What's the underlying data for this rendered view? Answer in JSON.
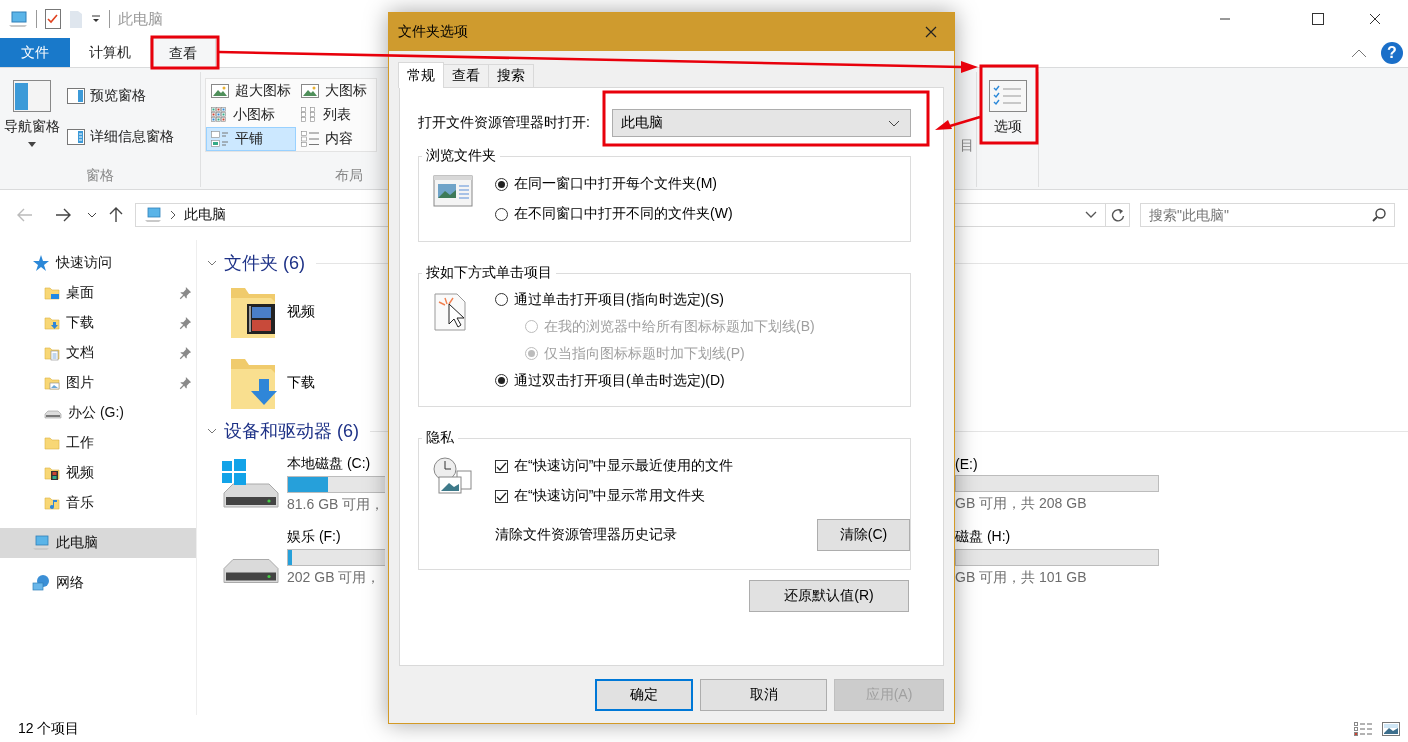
{
  "window": {
    "title": "此电脑"
  },
  "ribbon_tabs": [
    {
      "label": "文件",
      "kind": "file",
      "selected": false
    },
    {
      "label": "计算机",
      "kind": "tab",
      "selected": false
    },
    {
      "label": "查看",
      "kind": "tab",
      "selected": true
    }
  ],
  "help": "?",
  "ribbon": {
    "groups": [
      {
        "kind": "panes",
        "label": "窗格",
        "large": {
          "label": "导航窗格",
          "dropdown": true
        },
        "buttons": [
          {
            "label": "预览窗格"
          },
          {
            "label": "详细信息窗格"
          }
        ]
      },
      {
        "kind": "gallery",
        "label": "布局",
        "items": [
          {
            "label": "超大图标",
            "selected": false
          },
          {
            "label": "大图标",
            "selected": false
          },
          {
            "label": "小图标",
            "selected": false
          },
          {
            "label": "列表",
            "selected": false
          },
          {
            "label": "平铺",
            "selected": true
          },
          {
            "label": "内容",
            "selected": false
          }
        ]
      },
      {
        "kind": "partial",
        "label": "目"
      },
      {
        "kind": "options",
        "large": {
          "label": "选项"
        }
      }
    ]
  },
  "address": {
    "path": [
      "此电脑"
    ],
    "search_placeholder": "搜索\"此电脑\""
  },
  "navigation": [
    {
      "label": "快速访问",
      "kind": "star",
      "selected": false,
      "pinned": false,
      "children": [
        {
          "label": "桌面",
          "kind": "folder-desktop",
          "selected": false,
          "pinned": true
        },
        {
          "label": "下载",
          "kind": "folder-download",
          "selected": false,
          "pinned": true
        },
        {
          "label": "文档",
          "kind": "folder-documents",
          "selected": false,
          "pinned": true
        },
        {
          "label": "图片",
          "kind": "folder-pictures",
          "selected": false,
          "pinned": true
        },
        {
          "label": "办公 (G:)",
          "kind": "drive",
          "selected": false,
          "pinned": false
        },
        {
          "label": "工作",
          "kind": "folder",
          "selected": false,
          "pinned": false
        },
        {
          "label": "视频",
          "kind": "folder-video",
          "selected": false,
          "pinned": false
        },
        {
          "label": "音乐",
          "kind": "folder-music",
          "selected": false,
          "pinned": false
        }
      ]
    },
    {
      "label": "此电脑",
      "kind": "computer",
      "selected": true,
      "pinned": false
    },
    {
      "label": "网络",
      "kind": "network",
      "selected": false,
      "pinned": false
    }
  ],
  "content": {
    "folders": {
      "title": "文件夹 (6)",
      "expanded": true,
      "items": [
        {
          "name": "视频",
          "kind": "video"
        },
        {
          "name": "下载",
          "kind": "download"
        }
      ]
    },
    "drives": {
      "title": "设备和驱动器 (6)",
      "expanded": true,
      "items": [
        {
          "name": "本地磁盘 (C:)",
          "kind": "system",
          "level": 0.2,
          "free": "81.6 GB 可用，"
        },
        {
          "name": "(E:)",
          "free": "GB 可用，共 208 GB"
        },
        {
          "name": "娱乐 (F:)",
          "kind": "plain",
          "level": 0.02,
          "free": "202 GB 可用，"
        },
        {
          "name": "磁盘 (H:)",
          "free": "GB 可用，共 101 GB"
        }
      ]
    }
  },
  "status_bar": {
    "item_count": "12 个项目"
  },
  "dialog": {
    "title": "文件夹选项",
    "tabs": [
      {
        "label": "常规",
        "selected": true
      },
      {
        "label": "查看",
        "selected": false
      },
      {
        "label": "搜索",
        "selected": false
      }
    ],
    "open_in": {
      "label": "打开文件资源管理器时打开:",
      "value": "此电脑"
    },
    "groups": [
      {
        "title": "浏览文件夹",
        "kind": "window",
        "options": [
          {
            "kind": "radio",
            "label": "在同一窗口中打开每个文件夹(M)",
            "selected": true,
            "disabled": false
          },
          {
            "kind": "radio",
            "label": "在不同窗口中打开不同的文件夹(W)",
            "selected": false,
            "disabled": false
          }
        ]
      },
      {
        "title": "按如下方式单击项目",
        "kind": "click",
        "options": [
          {
            "kind": "radio",
            "label": "通过单击打开项目(指向时选定)(S)",
            "selected": false,
            "disabled": false,
            "children": [
              {
                "kind": "radio",
                "label": "在我的浏览器中给所有图标标题加下划线(B)",
                "selected": false,
                "disabled": true
              },
              {
                "kind": "radio",
                "label": "仅当指向图标标题时加下划线(P)",
                "selected": true,
                "disabled": true
              }
            ]
          },
          {
            "kind": "radio",
            "label": "通过双击打开项目(单击时选定)(D)",
            "selected": true,
            "disabled": false
          }
        ]
      },
      {
        "title": "隐私",
        "kind": "privacy",
        "options": [
          {
            "kind": "checkbox",
            "label": "在“快速访问”中显示最近使用的文件",
            "checked": true
          },
          {
            "kind": "checkbox",
            "label": "在“快速访问”中显示常用文件夹",
            "checked": true
          },
          {
            "kind": "action",
            "label": "清除文件资源管理器历史记录",
            "button": "清除(C)"
          }
        ]
      }
    ],
    "restore_button": "还原默认值(R)",
    "buttons": [
      {
        "label": "确定",
        "kind": "default",
        "disabled": false
      },
      {
        "label": "取消",
        "kind": "normal",
        "disabled": false
      },
      {
        "label": "应用(A)",
        "kind": "normal",
        "disabled": true
      }
    ]
  }
}
